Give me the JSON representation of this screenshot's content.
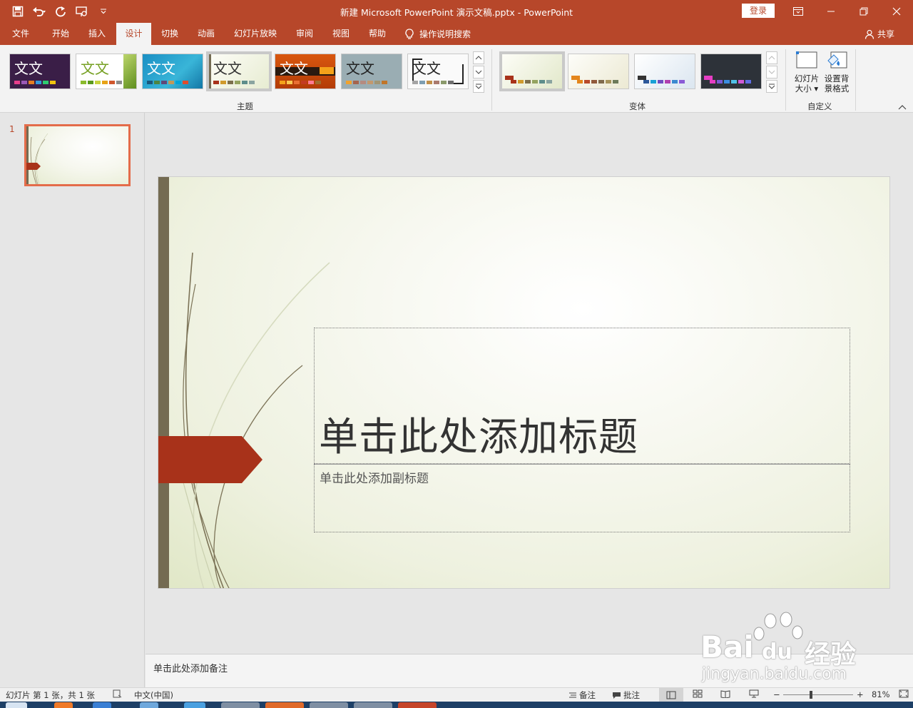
{
  "window": {
    "title": "新建 Microsoft PowerPoint 演示文稿.pptx  -  PowerPoint",
    "login_label": "登录"
  },
  "tabs": [
    {
      "label": "文件"
    },
    {
      "label": "开始"
    },
    {
      "label": "插入"
    },
    {
      "label": "设计"
    },
    {
      "label": "切换"
    },
    {
      "label": "动画"
    },
    {
      "label": "幻灯片放映"
    },
    {
      "label": "审阅"
    },
    {
      "label": "视图"
    },
    {
      "label": "帮助"
    }
  ],
  "active_tab": "设计",
  "tell_me": "操作说明搜索",
  "share": "共享",
  "ribbon": {
    "themes_group": "主题",
    "variants_group": "变体",
    "customize_group": "自定义",
    "theme_sample_text": "文文",
    "slide_size_line1": "幻灯片",
    "slide_size_line2": "大小",
    "format_bg_line1": "设置背",
    "format_bg_line2": "景格式"
  },
  "colors": {
    "accent": "#b7472a",
    "selection_border": "#e46c4a",
    "slide_arrow": "#a8321a",
    "slide_bar": "#746b52"
  },
  "thumbnail": {
    "number": "1"
  },
  "slide": {
    "title_placeholder": "单击此处添加标题",
    "subtitle_placeholder": "单击此处添加副标题"
  },
  "notes_placeholder": "单击此处添加备注",
  "status": {
    "slide_info": "幻灯片 第 1 张，共 1 张",
    "language": "中文(中国)",
    "notes_label": "备注",
    "comments_label": "批注",
    "zoom_minus": "−",
    "zoom_plus": "+",
    "zoom_percent": "81%"
  },
  "watermark": {
    "brand": "Bai",
    "brand_du": "du",
    "brand_cn": "经验",
    "url": "jingyan.baidu.com"
  }
}
